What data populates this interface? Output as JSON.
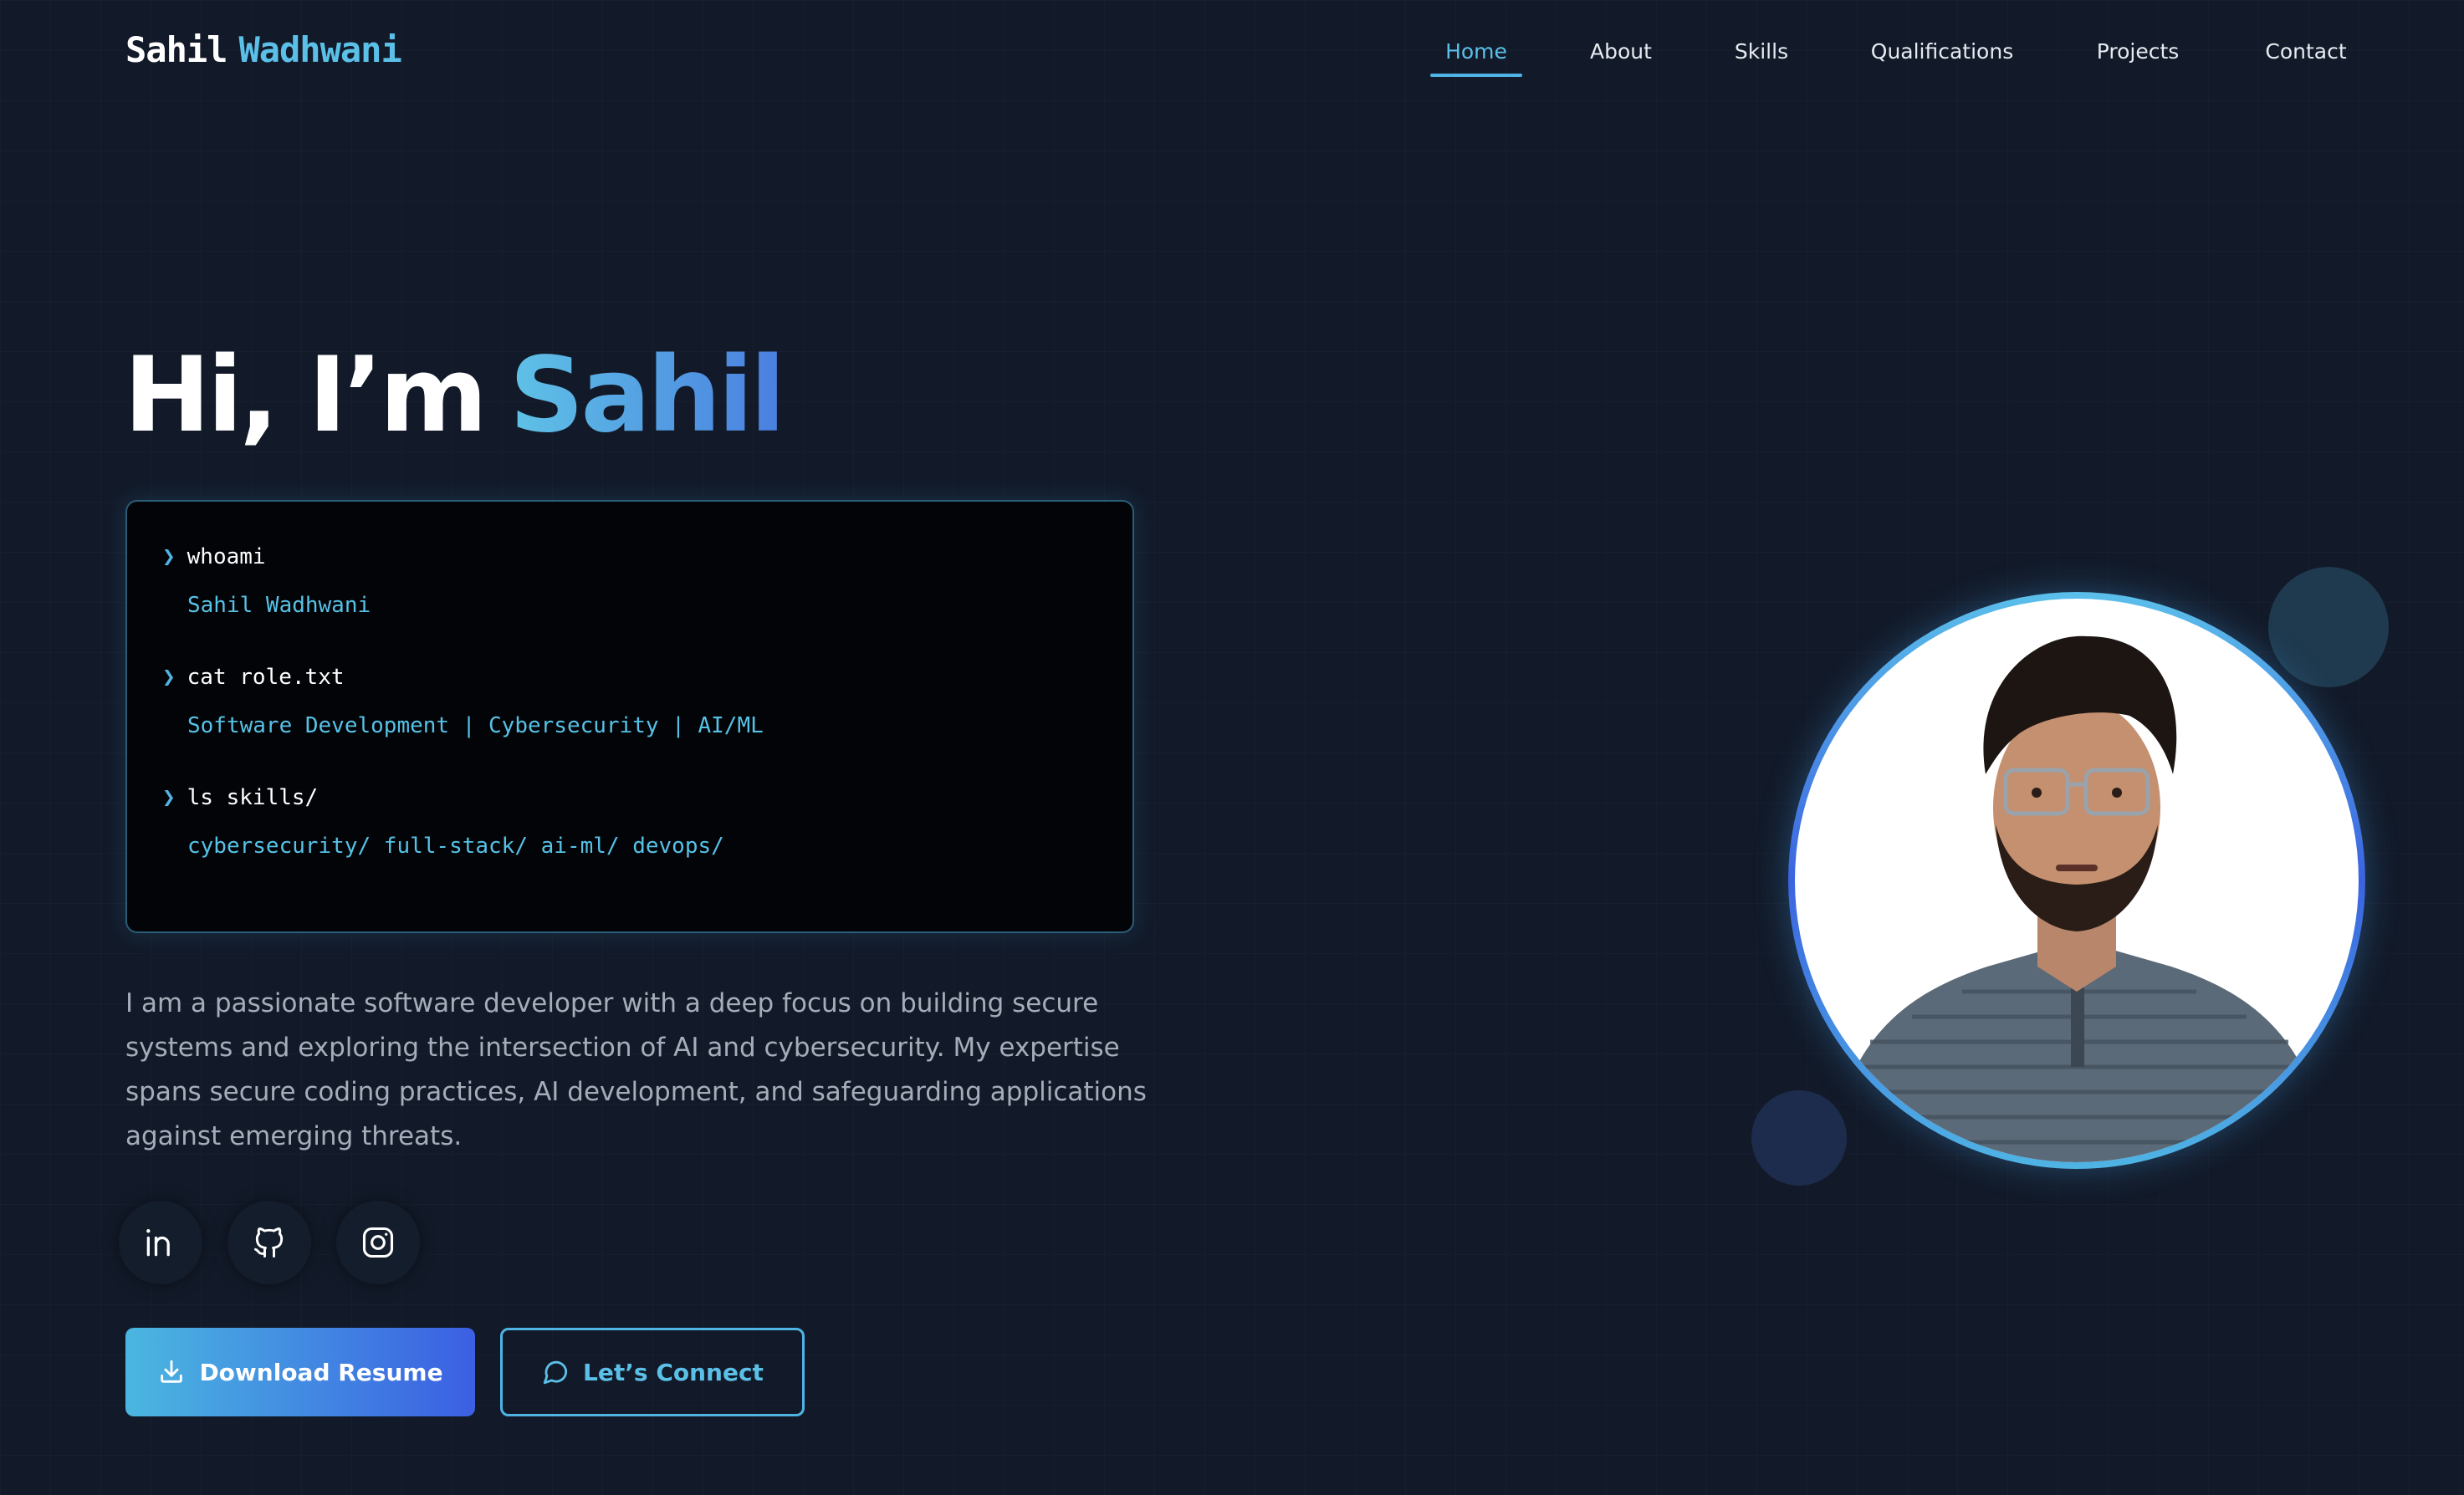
{
  "header": {
    "logo_first": "Sahil",
    "logo_last": "Wadhwani",
    "nav": [
      {
        "label": "Home",
        "active": true
      },
      {
        "label": "About"
      },
      {
        "label": "Skills"
      },
      {
        "label": "Qualifications"
      },
      {
        "label": "Projects"
      },
      {
        "label": "Contact"
      }
    ]
  },
  "hero": {
    "greeting": "Hi, I’m",
    "name": "Sahil",
    "terminal": [
      {
        "command": "whoami",
        "output": "Sahil Wadhwani"
      },
      {
        "command": "cat role.txt",
        "output": "Software Development | Cybersecurity | AI/ML"
      },
      {
        "command": "ls skills/",
        "output": "cybersecurity/ full-stack/ ai-ml/ devops/"
      }
    ],
    "prompt_symbol": "❯",
    "bio": "I am a passionate software developer with a deep focus on building secure systems and exploring the intersection of AI and cybersecurity. My expertise spans secure coding practices, AI development, and safeguarding applications against emerging threats.",
    "socials": [
      {
        "icon": "linkedin-icon"
      },
      {
        "icon": "github-icon"
      },
      {
        "icon": "instagram-icon"
      }
    ],
    "buttons": {
      "primary_label": "Download Resume",
      "primary_icon": "download-icon",
      "secondary_label": "Let’s Connect",
      "secondary_icon": "chat-bubble-icon"
    },
    "photo": {
      "icon": "profile-photo"
    }
  },
  "colors": {
    "background": "#121a29",
    "accent": "#5bc0e8",
    "accent_blue": "#3b5fe3",
    "terminal_bg": "#030408",
    "body_text": "#a6adb9"
  }
}
